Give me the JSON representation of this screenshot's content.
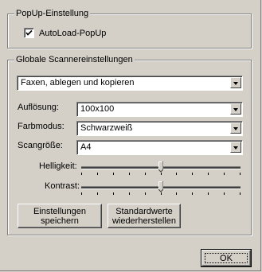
{
  "popup_group": {
    "title": "PopUp-Einstellung",
    "autoload_label": "AutoLoad-PopUp",
    "autoload_checked": true
  },
  "scanner_group": {
    "title": "Globale Scannereinstellungen",
    "mode_select_value": "Faxen, ablegen und kopieren",
    "resolution_label": "Auflösung:",
    "resolution_value": "100x100",
    "colormode_label": "Farbmodus:",
    "colormode_value": "Schwarzweiß",
    "scansize_label": "Scangröße:",
    "scansize_value": "A4",
    "brightness_label": "Helligkeit:",
    "brightness_level": 0.5,
    "contrast_label": "Kontrast:",
    "contrast_level": 0.5,
    "save_button_line1": "Einstellungen",
    "save_button_line2": "speichern",
    "restore_button_line1": "Standardwerte",
    "restore_button_line2": "wiederherstellen"
  },
  "ok_button_label": "OK"
}
